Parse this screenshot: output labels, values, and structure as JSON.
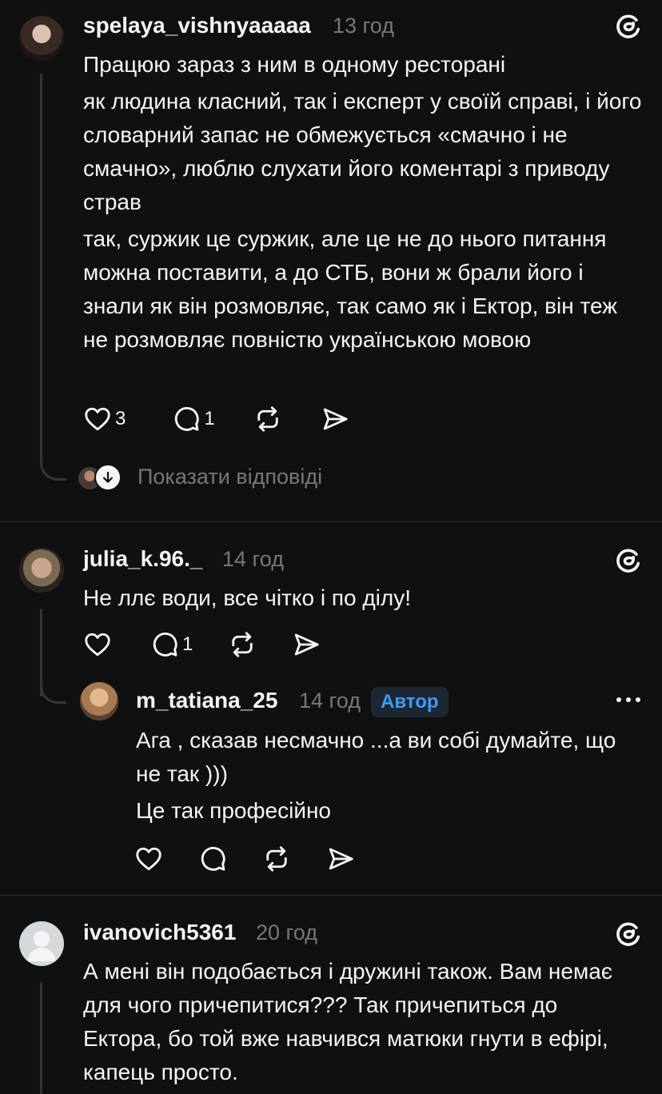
{
  "comments": [
    {
      "username": "spelaya_vishnyaaaaa",
      "time": "13 год",
      "paragraphs": [
        "Працюю зараз з ним в одному ресторані",
        "як людина класний, так і експерт у своїй справі, і його словарний запас не обмежується «смачно і не смачно», люблю слухати його коментарі з приводу страв",
        "так, суржик це суржик, але це не до нього питання можна поставити, а до СТБ, вони ж брали його і знали як він розмовляє, так само як і Ектор, він теж не розмовляє повністю українською мовою"
      ],
      "likes": "3",
      "replies": "1",
      "show_replies_label": "Показати відповіді"
    },
    {
      "username": "julia_k.96._",
      "time": "14 год",
      "text": "Не ллє води, все чітко і по ділу!",
      "likes": "",
      "replies": "1",
      "reply": {
        "username": "m_tatiana_25",
        "time": "14 год",
        "badge": "Автор",
        "paragraphs": [
          "Ага , сказав несмачно ...а ви собі думайте, що не так )))",
          "Це так професійно"
        ]
      }
    },
    {
      "username": "ivanovich5361",
      "time": "20 год",
      "text": "А мені він подобається і дружині також.  Вам немає для чого причепитися??? Так причепиться до Ектора, бо той вже навчився матюки гнути в ефірі, капець просто."
    }
  ],
  "icons": {
    "like": "heart-icon",
    "reply": "comment-bubble-icon",
    "repost": "repost-icon",
    "share": "send-icon",
    "app": "threads-logo-icon",
    "more": "more-dots-icon"
  },
  "colors": {
    "background": "#101010",
    "text": "#f3f5f7",
    "muted": "#777777",
    "badge_text": "#3d9bf2",
    "badge_bg": "#1d2633"
  }
}
